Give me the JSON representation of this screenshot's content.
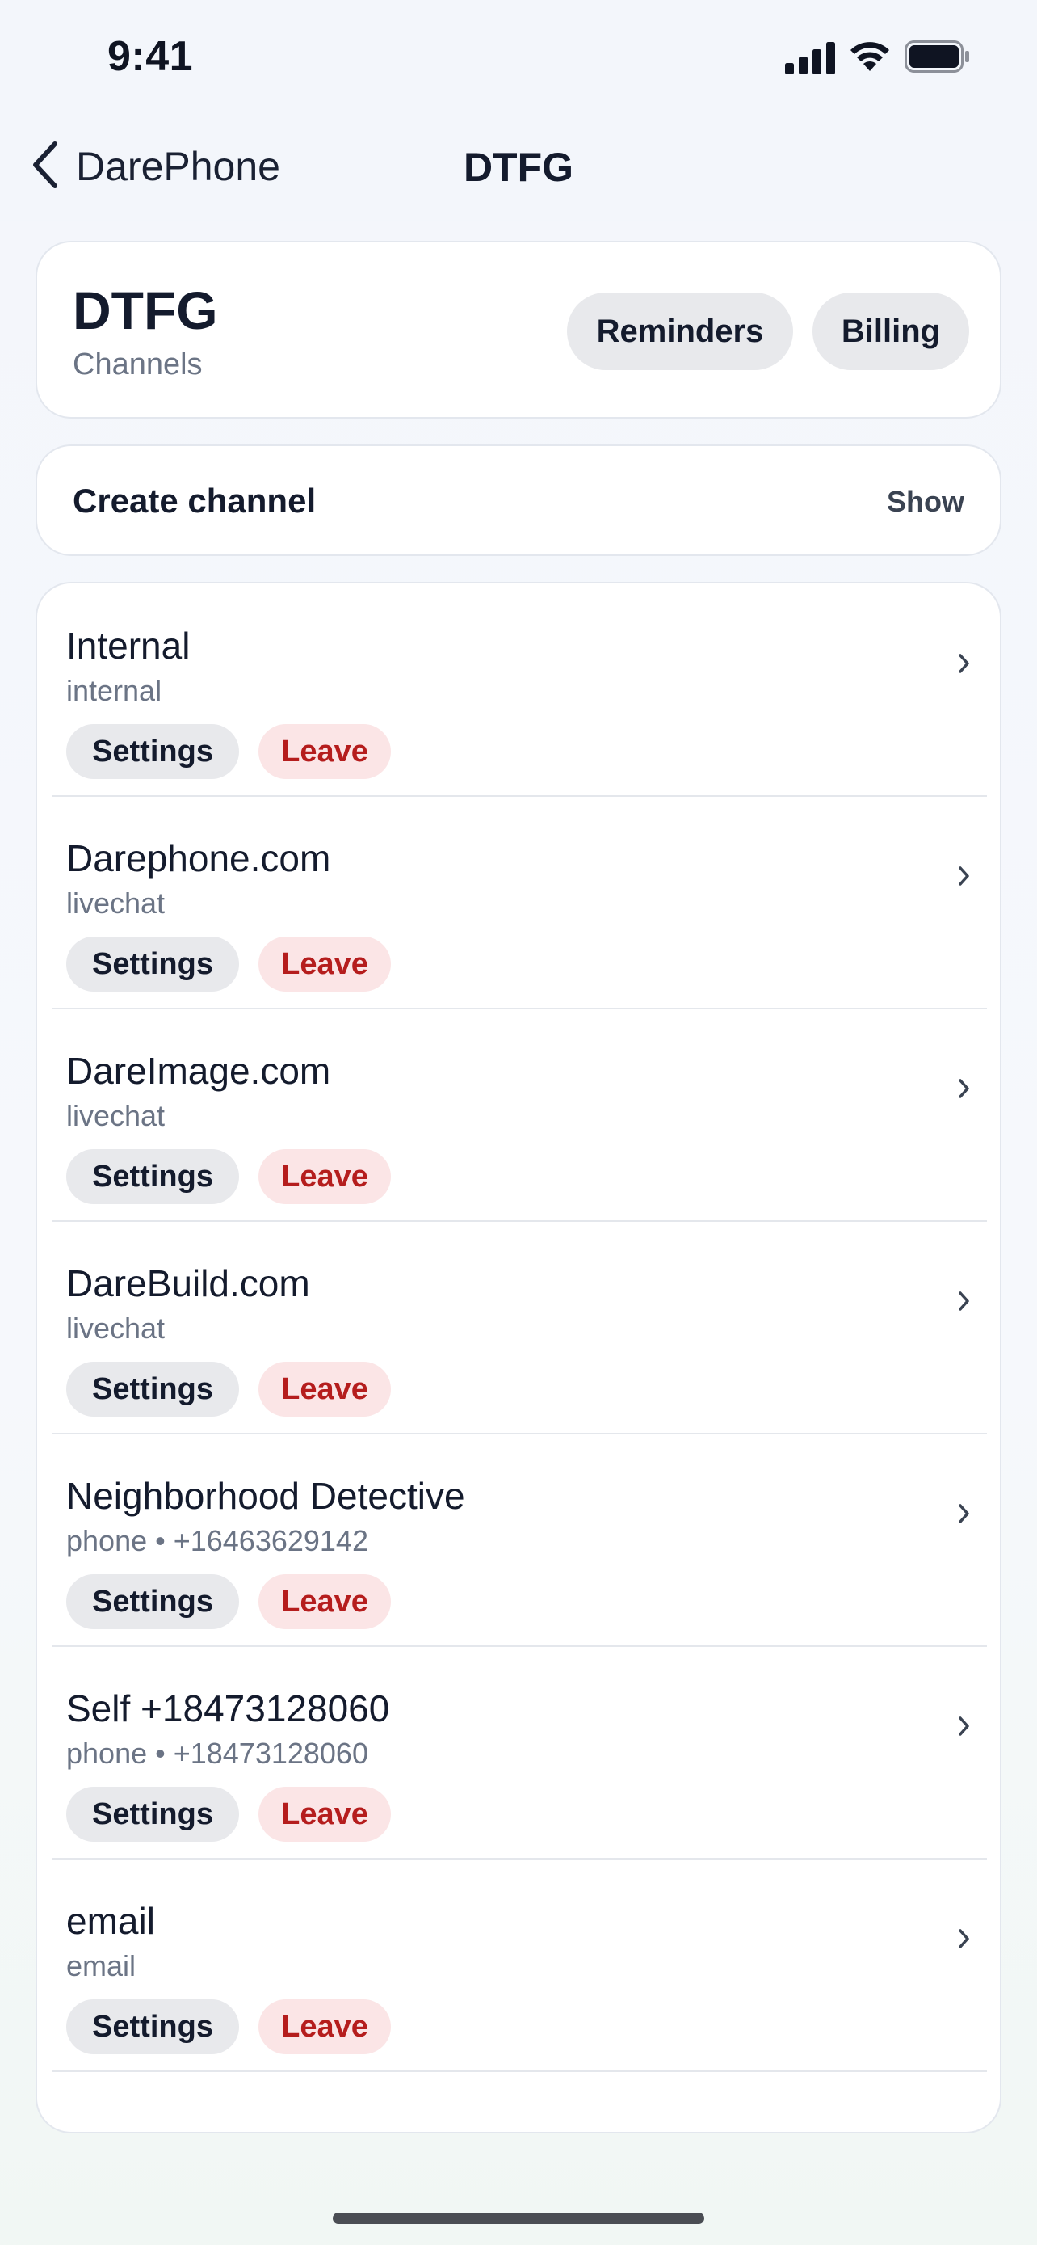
{
  "status_bar": {
    "time": "9:41"
  },
  "nav": {
    "back_label": "DarePhone",
    "title": "DTFG"
  },
  "header": {
    "org_name": "DTFG",
    "subtitle": "Channels",
    "reminders_label": "Reminders",
    "billing_label": "Billing"
  },
  "create": {
    "label": "Create channel",
    "toggle_label": "Show"
  },
  "buttons": {
    "settings": "Settings",
    "leave": "Leave"
  },
  "channels": [
    {
      "name": "Internal",
      "sub": "internal"
    },
    {
      "name": "Darephone.com",
      "sub": "livechat"
    },
    {
      "name": "DareImage.com",
      "sub": "livechat"
    },
    {
      "name": "DareBuild.com",
      "sub": "livechat"
    },
    {
      "name": "Neighborhood Detective",
      "sub": "phone • +16463629142"
    },
    {
      "name": "Self +18473128060",
      "sub": "phone • +18473128060"
    },
    {
      "name": "email",
      "sub": "email"
    }
  ],
  "icons": {
    "back": "chevron-left-icon",
    "row": "chevron-right-icon",
    "signal": "cellular-signal-icon",
    "wifi": "wifi-icon",
    "battery": "battery-icon"
  },
  "colors": {
    "leave_text": "#b51d1d",
    "leave_bg": "#fbe5e6",
    "pill_bg": "#e8e9ec"
  }
}
